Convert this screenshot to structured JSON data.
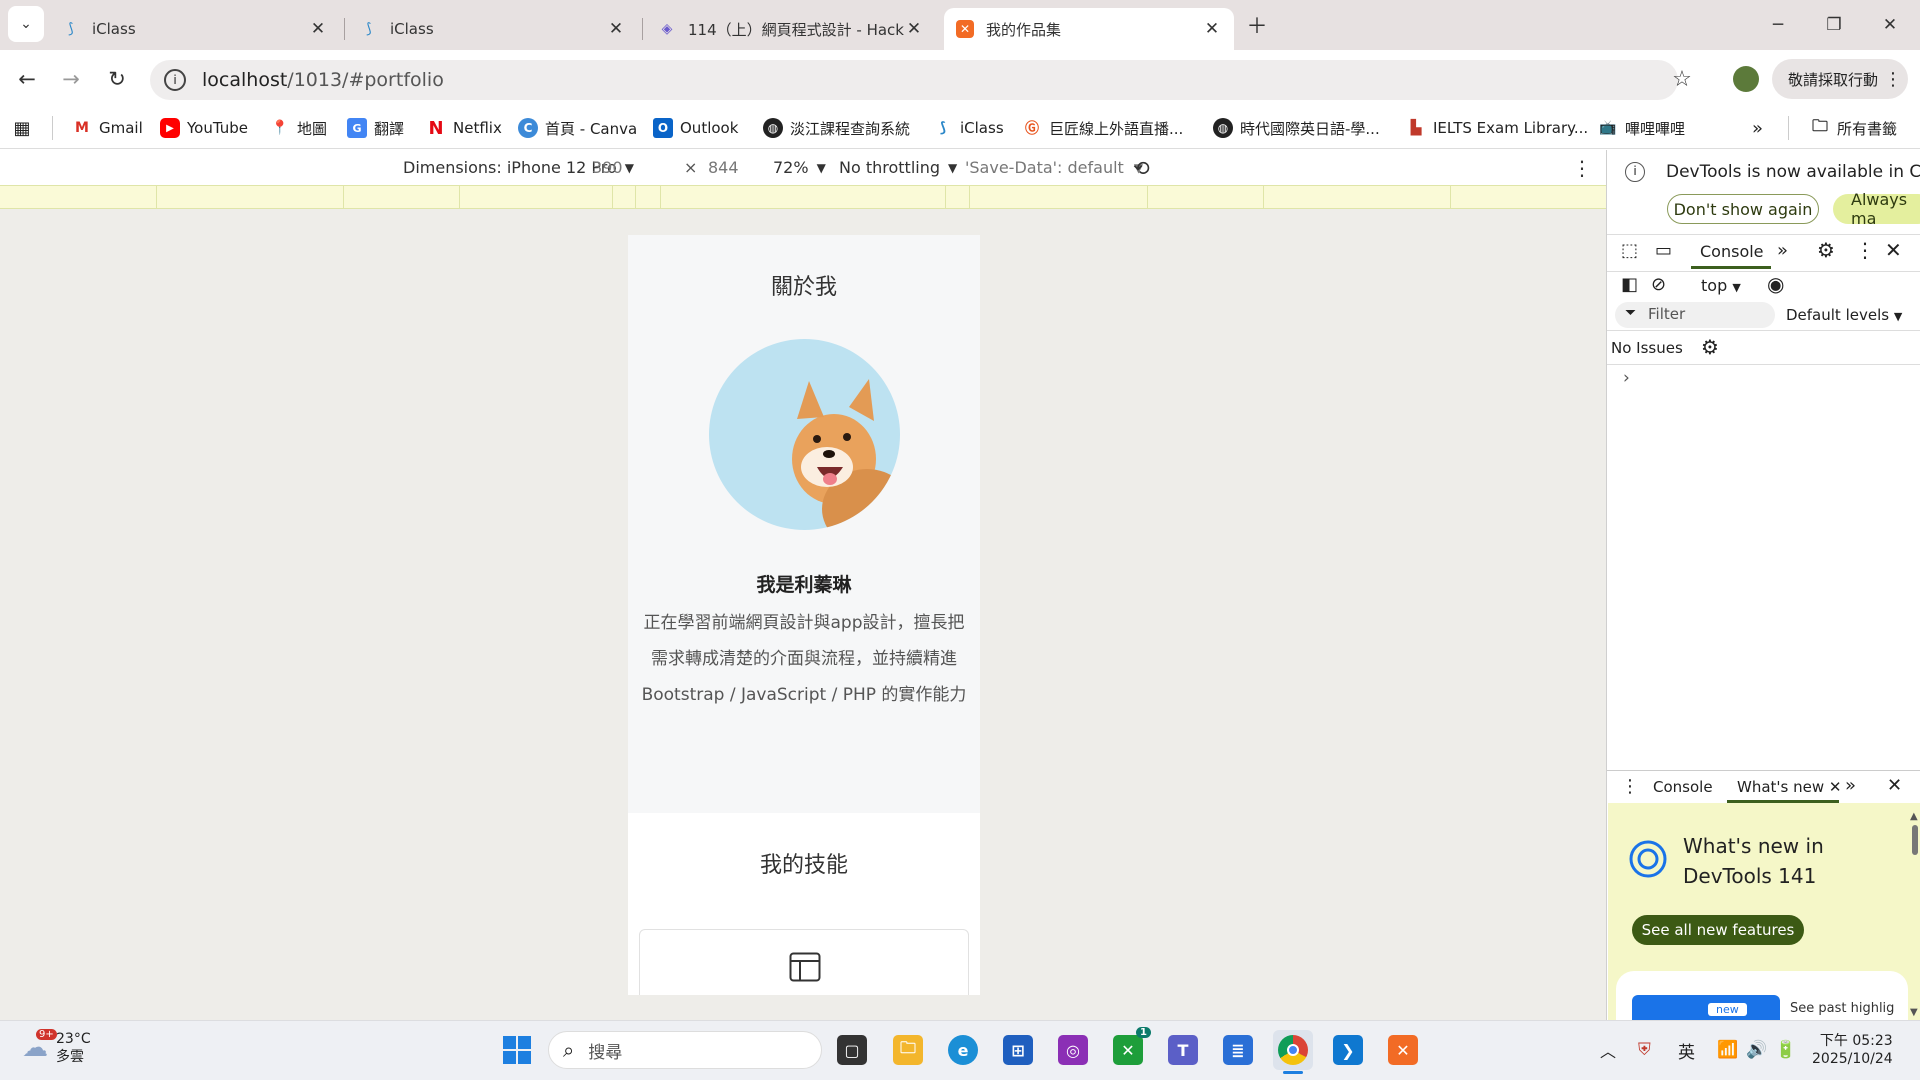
{
  "colors": {
    "tabstrip_bg": "#e7e1e1",
    "viewport_bg": "#eeede9",
    "devtools_accent": "#3c5f1e",
    "whatsnew_bg": "#f5f7c8",
    "chip_green": "#3c5a14",
    "avatar_bg": "#bde2f1"
  },
  "browser": {
    "tabs": [
      {
        "title": "iClass",
        "icon": "iclass-icon"
      },
      {
        "title": "iClass",
        "icon": "iclass-icon"
      },
      {
        "title": "114（上）網頁程式設計 - Hack",
        "icon": "hackmd-icon"
      },
      {
        "title": "我的作品集",
        "icon": "xampp-icon"
      }
    ],
    "address": {
      "host": "localhost",
      "path": "/1013/#portfolio"
    },
    "profile_label": "敬請採取行動",
    "bookmarks": [
      {
        "label": "Gmail",
        "icon": "gmail-icon"
      },
      {
        "label": "YouTube",
        "icon": "youtube-icon"
      },
      {
        "label": "地圖",
        "icon": "maps-icon"
      },
      {
        "label": "翻譯",
        "icon": "translate-icon"
      },
      {
        "label": "Netflix",
        "icon": "netflix-icon"
      },
      {
        "label": "首頁 - Canva",
        "icon": "canva-icon"
      },
      {
        "label": "Outlook",
        "icon": "outlook-icon"
      },
      {
        "label": "淡江課程查詢系統",
        "icon": "globe-icon"
      },
      {
        "label": "iClass",
        "icon": "iclass-icon"
      },
      {
        "label": "巨匠線上外語直播...",
        "icon": "gjun-icon"
      },
      {
        "label": "時代國際英日語-學...",
        "icon": "globe-icon"
      },
      {
        "label": "IELTS Exam Library...",
        "icon": "ielts-icon"
      },
      {
        "label": "嗶哩嗶哩",
        "icon": "bilibili-icon"
      }
    ],
    "all_bookmarks_label": "所有書籤"
  },
  "device_toolbar": {
    "dimensions_label": "Dimensions: iPhone 12 Pro",
    "width": "390",
    "times": "×",
    "height": "844",
    "zoom": "72%",
    "throttling": "No throttling",
    "save_data": "'Save-Data': default"
  },
  "page": {
    "about_title": "關於我",
    "name": "我是利蓁琳",
    "bio": "正在學習前端網頁設計與app設計，擅長把需求轉成清楚的介面與流程，並持續精進 Bootstrap / JavaScript / PHP 的實作能力",
    "skills_title": "我的技能"
  },
  "devtools": {
    "banner_text": "DevTools is now available in Chine",
    "dont_show": "Don't show again",
    "always": "Always ma",
    "console_tab": "Console",
    "context": "top",
    "filter_placeholder": "Filter",
    "levels": "Default levels",
    "issues": "No Issues",
    "prompt": "›",
    "drawer_console": "Console",
    "drawer_whatsnew": "What's new",
    "whatsnew_title": "What's new in DevTools 141",
    "see_all": "See all new features",
    "badge_new": "new",
    "past_highlights": "See past highlig"
  },
  "taskbar": {
    "temperature": "23°C",
    "weather": "多雲",
    "weather_badge": "9+",
    "search_placeholder": "搜尋",
    "xbox_badge": "1",
    "ime": "英",
    "time": "下午 05:23",
    "date": "2025/10/24"
  }
}
